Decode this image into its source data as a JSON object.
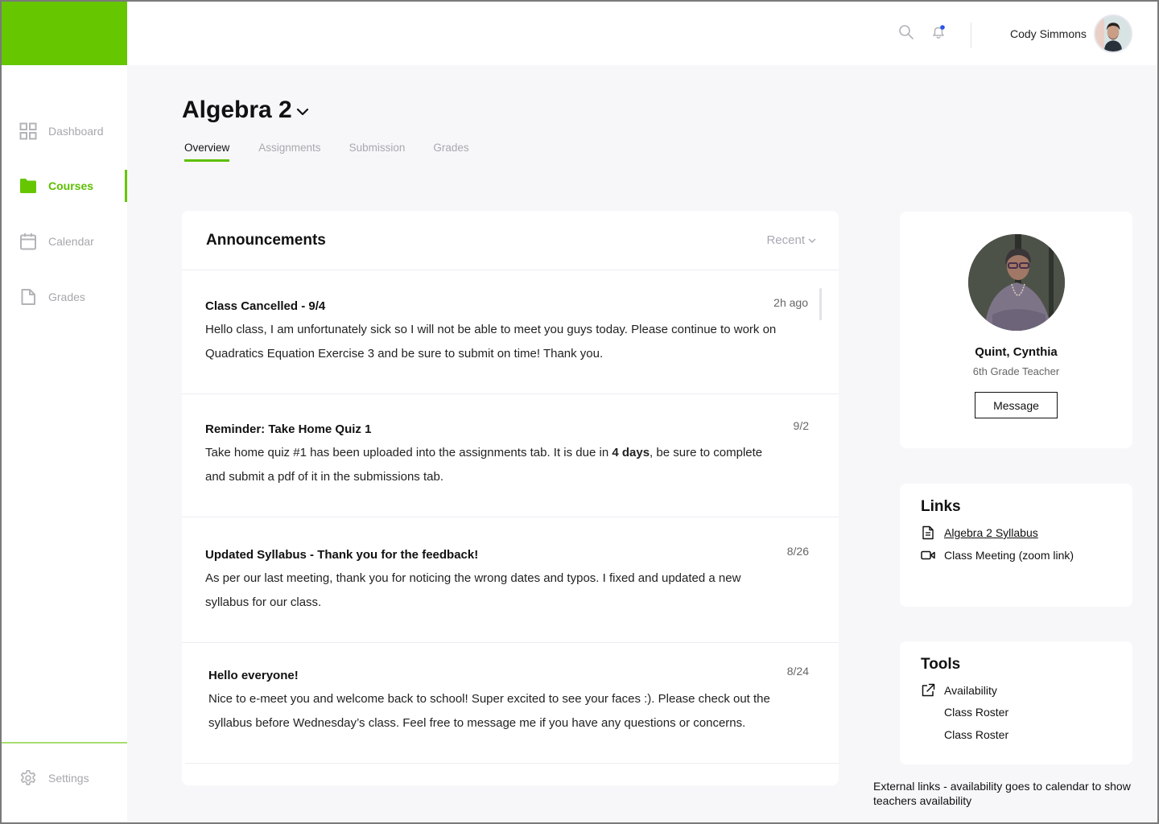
{
  "brand": {
    "accent": "#66c600",
    "accent_text": "#5cbf00"
  },
  "sidebar": {
    "items": [
      {
        "label": "Dashboard",
        "icon": "grid-icon",
        "active": false
      },
      {
        "label": "Courses",
        "icon": "folder-icon",
        "active": true
      },
      {
        "label": "Calendar",
        "icon": "calendar-icon",
        "active": false
      },
      {
        "label": "Grades",
        "icon": "document-icon",
        "active": false
      }
    ],
    "settings": {
      "label": "Settings",
      "icon": "gear-icon"
    }
  },
  "header": {
    "user_name": "Cody Simmons",
    "notification_dot": true,
    "icons": [
      "search-icon",
      "bell-icon"
    ]
  },
  "course": {
    "title": "Algebra 2",
    "tabs": [
      {
        "label": "Overview",
        "active": true
      },
      {
        "label": "Assignments",
        "active": false
      },
      {
        "label": "Submission",
        "active": false
      },
      {
        "label": "Grades",
        "active": false
      }
    ]
  },
  "announcements": {
    "title": "Announcements",
    "sort_label": "Recent",
    "items": [
      {
        "title": "Class Cancelled - 9/4",
        "date": "2h ago",
        "body": "Hello class, I am unfortunately sick so I will not be able to meet you guys today. Please continue to work on Quadratics Equation Exercise 3 and be sure to submit on time! Thank you."
      },
      {
        "title": "Reminder: Take Home Quiz 1",
        "date": "9/2",
        "body_pre": "Take home quiz #1 has been uploaded into the assignments tab. It is due in ",
        "body_bold": "4 days",
        "body_post": ", be sure to complete and submit a pdf of it in the submissions tab."
      },
      {
        "title": "Updated Syllabus - Thank you for the feedback!",
        "date": "8/26",
        "body": "As per our last meeting, thank you for noticing the wrong dates and typos. I fixed and updated a new syllabus for our class."
      },
      {
        "title": "Hello everyone!",
        "date": "8/24",
        "body": "Nice to e-meet you and welcome back to school! Super excited to see your faces :). Please check out the syllabus before Wednesday’s class. Feel free to message me if you have any questions or concerns."
      }
    ]
  },
  "teacher": {
    "name": "Quint, Cynthia",
    "role": "6th Grade Teacher",
    "message_label": "Message"
  },
  "links": {
    "title": "Links",
    "items": [
      {
        "label": "Algebra 2 Syllabus",
        "icon": "document-icon",
        "underlined": true
      },
      {
        "label": "Class Meeting (zoom link)",
        "icon": "video-camera-icon",
        "underlined": false
      }
    ]
  },
  "tools": {
    "title": "Tools",
    "items": [
      {
        "label": "Availability",
        "icon": "external-link-icon"
      },
      {
        "label": "Class Roster",
        "icon": null
      },
      {
        "label": "Class Roster",
        "icon": null
      }
    ]
  },
  "annotation_note": "External links - availability goes to calendar to show teachers availability"
}
